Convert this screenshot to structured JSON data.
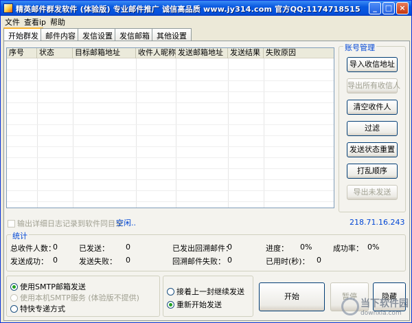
{
  "window": {
    "title": "精英邮件群发软件 (体验版)   专业邮件推广 诚信高品质   www.jy314.com   官方QQ:1174718515"
  },
  "menu": [
    "文件",
    "查看ip",
    "帮助"
  ],
  "tabs": [
    "开始群发",
    "邮件内容",
    "发信设置",
    "发信邮箱",
    "其他设置"
  ],
  "table": {
    "columns": [
      "序号",
      "状态",
      "目标邮箱地址",
      "收件人昵称",
      "发送邮箱地址",
      "发送结果",
      "失败原因"
    ]
  },
  "account_panel": {
    "title": "账号管理",
    "buttons": [
      {
        "label": "导入收信地址",
        "enabled": true
      },
      {
        "label": "导出所有收信人",
        "enabled": false
      },
      {
        "label": "清空收件人",
        "enabled": true
      },
      {
        "label": "过滤",
        "enabled": true
      },
      {
        "label": "发送状态重置",
        "enabled": true
      },
      {
        "label": "打乱顺序",
        "enabled": true
      },
      {
        "label": "导出未发送",
        "enabled": false
      }
    ]
  },
  "log_checkbox": "输出详细日志记录到软件同目录",
  "status_text": "空闲..",
  "ip": "218.71.16.243",
  "stats": {
    "title": "统计",
    "total_label": "总收件人数：",
    "total": "0",
    "sent_label": "已发送：",
    "sent": "0",
    "receipt_label": "已发出回溯邮件：",
    "receipt": "0",
    "progress_label": "进度：",
    "progress": "0%",
    "rate_label": "成功率：",
    "rate": "0%",
    "success_label": "发送成功：",
    "success": "0",
    "fail_label": "发送失败：",
    "fail": "0",
    "receipt_fail_label": "回溯邮件失败：",
    "receipt_fail": "0",
    "elapsed_label": "已用时(秒)：",
    "elapsed": "0"
  },
  "send_modes": [
    {
      "label": "使用SMTP邮箱发送",
      "selected": true,
      "enabled": true
    },
    {
      "label": "使用本机SMTP服务 (体验版不提供)",
      "selected": false,
      "enabled": false
    },
    {
      "label": "特快专递方式",
      "selected": false,
      "enabled": true
    }
  ],
  "continue_modes": [
    {
      "label": "接着上一封继续发送",
      "selected": false
    },
    {
      "label": "重新开始发送",
      "selected": true
    }
  ],
  "actions": {
    "start": "开始",
    "pause": "暂停",
    "hide": "隐藏"
  },
  "watermark": {
    "text": "当下软件园",
    "sub": "downxia.com"
  }
}
